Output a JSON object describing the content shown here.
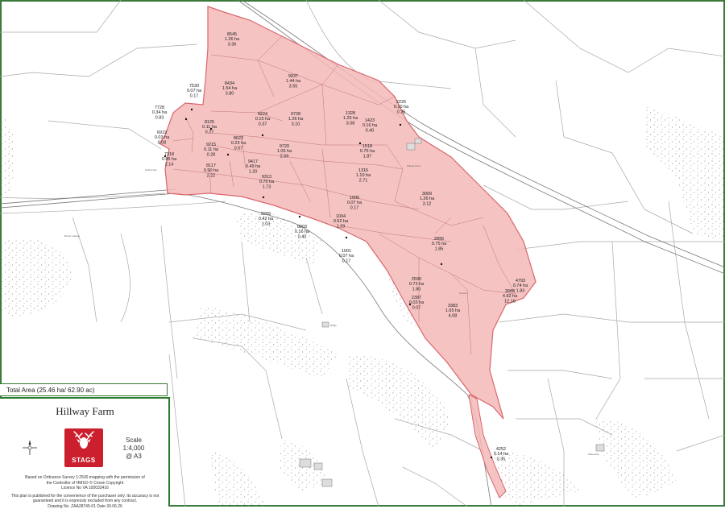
{
  "map": {
    "title": "Hillway Farm",
    "total_area": "Total Area (25.46 ha/ 62.90 ac)",
    "scale_label": "Scale",
    "scale_ratio": "1:4,000",
    "scale_paper": "@ A3",
    "logo_text": "STAGS",
    "credits": {
      "line1": "Based on Ordnance Survey 1:2500 mapping with the permission of",
      "line2": "the Controller of HMSO   © Crown Copyright",
      "line3": "Licence No VA 100033416",
      "line4": "This plan is published for the convenience of the purchaser only. Its accuracy is not",
      "line5": "guaranteed and it is expressly excluded from any contract.",
      "line6": "Drawing No. ZAA28745-01   Date 30.06.26"
    },
    "highlight_color": "#f5b8b8",
    "highlight_border": "#d9666b",
    "frame_color": "#2f7a2f",
    "logo_color": "#cc1f2e",
    "icons": [
      "compass-rose-icon",
      "stag-head-icon"
    ]
  },
  "parcels": [
    {
      "id": "8545",
      "ha": "1.36 ha",
      "ac": "3.36"
    },
    {
      "id": "7530",
      "ha": "0.07 ha",
      "ac": "0.17"
    },
    {
      "id": "8434",
      "ha": "1.54 ha",
      "ac": "3.80"
    },
    {
      "id": "9937",
      "ha": "1.44 ha",
      "ac": "3.55"
    },
    {
      "id": "7728",
      "ha": "0.34 ha",
      "ac": "0.83"
    },
    {
      "id": "8125",
      "ha": "0.11 ha",
      "ac": "0.27"
    },
    {
      "id": "9224",
      "ha": "0.15 ha",
      "ac": "0.37"
    },
    {
      "id": "9728",
      "ha": "1.26 ha",
      "ac": "3.10"
    },
    {
      "id": "1328",
      "ha": "1.25 ha",
      "ac": "3.08"
    },
    {
      "id": "1423",
      "ha": "0.16 ha",
      "ac": "0.40"
    },
    {
      "id": "2226",
      "ha": "0.10 ha",
      "ac": "0.25"
    },
    {
      "id": "6919",
      "ha": "0.03 ha",
      "ac": "0.08"
    },
    {
      "id": "9215",
      "ha": "0.11 ha",
      "ac": "0.28"
    },
    {
      "id": "8622",
      "ha": "0.23 ha",
      "ac": "0.57"
    },
    {
      "id": "9720",
      "ha": "1.05 ha",
      "ac": "2.59"
    },
    {
      "id": "1518",
      "ha": "0.75 ha",
      "ac": "1.87"
    },
    {
      "id": "7318",
      "ha": "0.86 ha",
      "ac": "2.14"
    },
    {
      "id": "8117",
      "ha": "0.90 ha",
      "ac": "2.22"
    },
    {
      "id": "9417",
      "ha": "0.49 ha",
      "ac": "1.20"
    },
    {
      "id": "9313",
      "ha": "0.70 ha",
      "ac": "1.73"
    },
    {
      "id": "1315",
      "ha": "1.10 ha",
      "ac": "2.71"
    },
    {
      "id": "3009",
      "ha": "1.26 ha",
      "ac": "3.12"
    },
    {
      "id": "1005",
      "ha": "0.07 ha",
      "ac": "0.17"
    },
    {
      "id": "9209",
      "ha": "0.42 ha",
      "ac": "1.03"
    },
    {
      "id": "1004",
      "ha": "0.52 ha",
      "ac": "1.29"
    },
    {
      "id": "0803",
      "ha": "0.16 ha",
      "ac": "0.40"
    },
    {
      "id": "2895",
      "ha": "0.75 ha",
      "ac": "1.85"
    },
    {
      "id": "1001",
      "ha": "0.07 ha",
      "ac": "0.17"
    },
    {
      "id": "2590",
      "ha": "0.73 ha",
      "ac": "1.80"
    },
    {
      "id": "3988",
      "ha": "4.92 ha",
      "ac": "12.16"
    },
    {
      "id": "4793",
      "ha": "0.74 ha",
      "ac": "1.83"
    },
    {
      "id": "2387",
      "ha": "0.03 ha",
      "ac": "0.07"
    },
    {
      "id": "3383",
      "ha": "1.65 ha",
      "ac": "4.08"
    },
    {
      "id": "4252",
      "ha": "0.14 ha",
      "ac": "0.35"
    }
  ]
}
